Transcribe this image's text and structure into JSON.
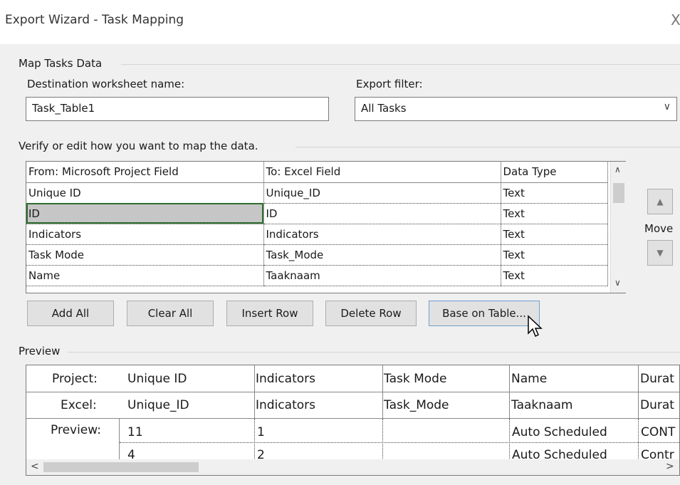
{
  "window": {
    "title": "Export Wizard - Task Mapping",
    "close_glyph": "X"
  },
  "map_group": {
    "label": "Map Tasks Data"
  },
  "destination": {
    "label": "Destination worksheet name:",
    "value": "Task_Table1"
  },
  "filter": {
    "label": "Export filter:",
    "value": "All Tasks"
  },
  "verify_label": "Verify or edit how you want to map the data.",
  "mapping": {
    "headers": [
      "From: Microsoft Project Field",
      "To:  Excel Field",
      "Data Type"
    ],
    "rows": [
      [
        "Unique ID",
        "Unique_ID",
        "Text"
      ],
      [
        "ID",
        "ID",
        "Text"
      ],
      [
        "Indicators",
        "Indicators",
        "Text"
      ],
      [
        "Task Mode",
        "Task_Mode",
        "Text"
      ],
      [
        "Name",
        "Taaknaam",
        "Text"
      ]
    ]
  },
  "move_label": "Move",
  "buttons": {
    "add_all": "Add All",
    "clear_all": "Clear All",
    "insert_row": "Insert Row",
    "delete_row": "Delete Row",
    "base_on_table": "Base on Table..."
  },
  "preview": {
    "label": "Preview",
    "project_label": "Project:",
    "excel_label": "Excel:",
    "preview_label": "Preview:",
    "project_row": [
      "Unique ID",
      "Indicators",
      "Task Mode",
      "Name",
      "Durat"
    ],
    "excel_row": [
      "Unique_ID",
      "Indicators",
      "Task_Mode",
      "Taaknaam",
      "Durat"
    ],
    "data_rows": [
      [
        "11",
        "1",
        "",
        "Auto Scheduled",
        "CONT"
      ],
      [
        "4",
        "2",
        "",
        "Auto Scheduled",
        "Contr"
      ]
    ]
  }
}
